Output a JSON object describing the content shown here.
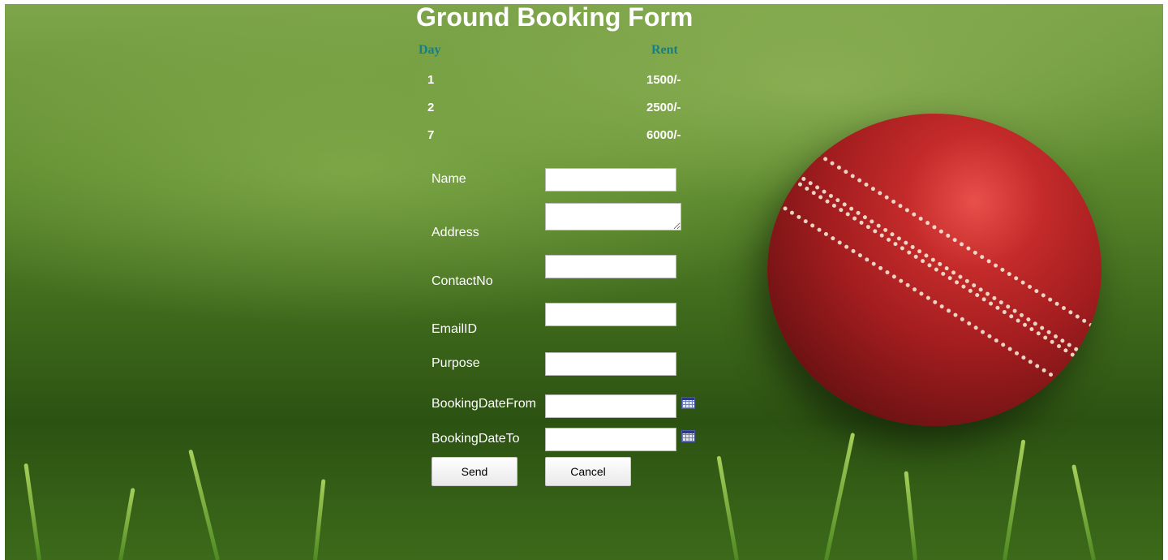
{
  "page_title": "Ground Booking Form",
  "rent_table": {
    "headers": {
      "day": "Day",
      "rent": "Rent"
    },
    "rows": [
      {
        "day": "1",
        "rent": "1500/-"
      },
      {
        "day": "2",
        "rent": "2500/-"
      },
      {
        "day": "7",
        "rent": "6000/-"
      }
    ]
  },
  "form": {
    "name_label": "Name",
    "name_value": "",
    "address_label": "Address",
    "address_value": "",
    "contact_label": "ContactNo",
    "contact_value": "",
    "email_label": "EmailID",
    "email_value": "",
    "purpose_label": "Purpose",
    "purpose_value": "",
    "date_from_label": "BookingDateFrom",
    "date_from_value": "",
    "date_to_label": "BookingDateTo",
    "date_to_value": "",
    "calendar_icon": "calendar-icon"
  },
  "buttons": {
    "send": "Send",
    "cancel": "Cancel"
  },
  "colors": {
    "table_header": "#137f87",
    "label_text": "#ffffff"
  }
}
